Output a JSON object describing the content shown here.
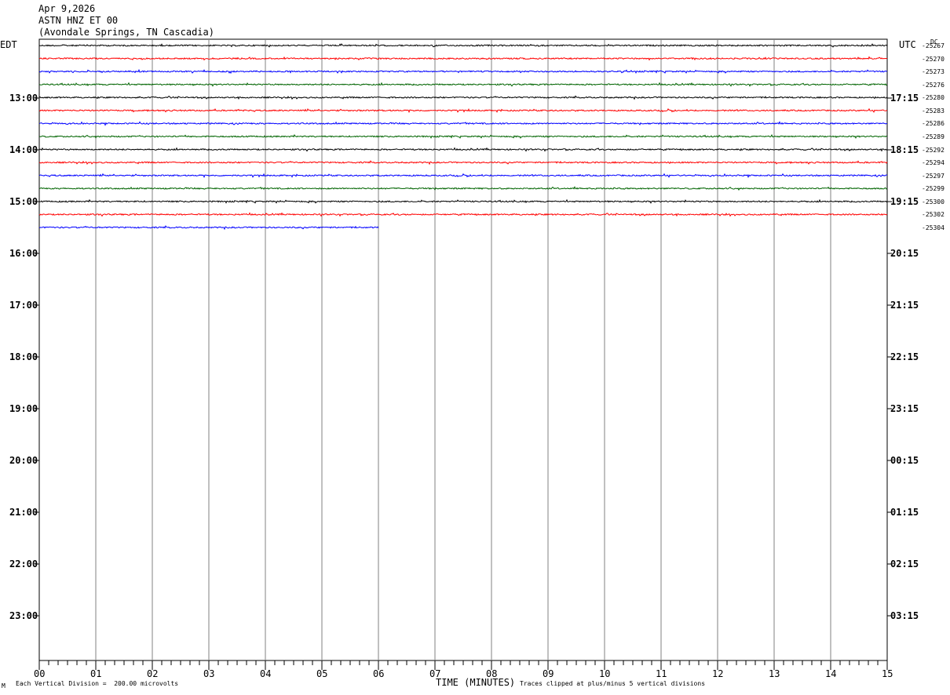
{
  "header": {
    "date": "Apr 9,2026",
    "station": "ASTN HNZ ET 00",
    "location": "(Avondale Springs, TN Cascadia)"
  },
  "left_zone_label": "EDT",
  "right_zone_label": "UTC",
  "dc_label": "DC",
  "footer": {
    "mark": "M",
    "scale_note": "Each Vertical Division =  200.00 microvolts",
    "clip_note": "Traces clipped at plus/minus 5 vertical divisions"
  },
  "chart_data": {
    "type": "line",
    "title": "ASTN HNZ ET 00",
    "xlabel": "TIME (MINUTES)",
    "xlim": [
      0,
      15
    ],
    "x_ticks": [
      "00",
      "01",
      "02",
      "03",
      "04",
      "05",
      "06",
      "07",
      "08",
      "09",
      "10",
      "11",
      "12",
      "13",
      "14",
      "15"
    ],
    "left_hour_labels": [
      "13:00",
      "14:00",
      "15:00",
      "16:00",
      "17:00",
      "18:00",
      "19:00",
      "20:00",
      "21:00",
      "22:00",
      "23:00"
    ],
    "right_hour_labels": [
      "17:15",
      "18:15",
      "19:15",
      "20:15",
      "21:15",
      "22:15",
      "23:15",
      "00:15",
      "01:15",
      "02:15",
      "03:15"
    ],
    "trace_colors": [
      "#000000",
      "#ff0000",
      "#0000ff",
      "#006400"
    ],
    "traces": [
      {
        "dc": "-25267",
        "end_minute": 15
      },
      {
        "dc": "-25270",
        "end_minute": 15
      },
      {
        "dc": "-25273",
        "end_minute": 15
      },
      {
        "dc": "-25276",
        "end_minute": 15
      },
      {
        "dc": "-25280",
        "end_minute": 15
      },
      {
        "dc": "-25283",
        "end_minute": 15
      },
      {
        "dc": "-25286",
        "end_minute": 15
      },
      {
        "dc": "-25289",
        "end_minute": 15
      },
      {
        "dc": "-25292",
        "end_minute": 15
      },
      {
        "dc": "-25294",
        "end_minute": 15
      },
      {
        "dc": "-25297",
        "end_minute": 15
      },
      {
        "dc": "-25299",
        "end_minute": 15
      },
      {
        "dc": "-25300",
        "end_minute": 15
      },
      {
        "dc": "-25302",
        "end_minute": 15
      },
      {
        "dc": "-25304",
        "end_minute": 6
      }
    ]
  }
}
